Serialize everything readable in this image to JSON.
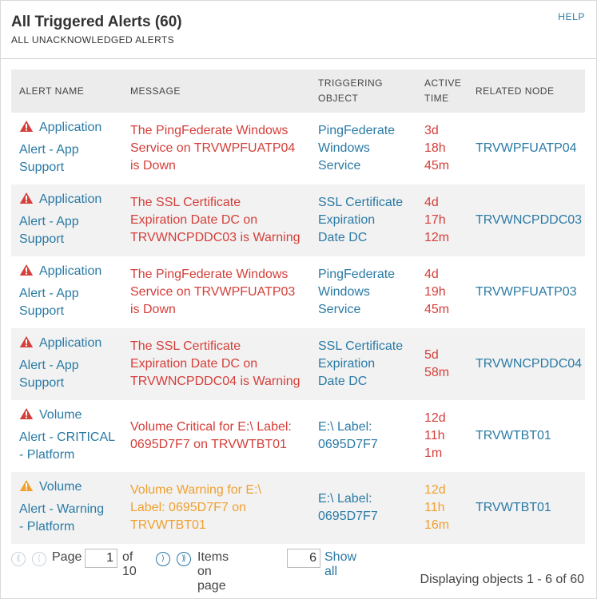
{
  "header": {
    "title": "All Triggered Alerts (60)",
    "subtitle": "ALL UNACKNOWLEDGED ALERTS",
    "help": "HELP"
  },
  "columns": {
    "alert_name": "ALERT NAME",
    "message": "MESSAGE",
    "triggering_line1": "TRIGGERING",
    "triggering_line2": "OBJECT",
    "active_line1": "ACTIVE",
    "active_line2": "TIME",
    "related_node": "RELATED NODE"
  },
  "rows": [
    {
      "name_line1": "Application",
      "name_line2": "Alert - App",
      "name_line3": "Support",
      "msg1": "The PingFederate Windows",
      "msg2": "Service on TRVWPFUATP04",
      "msg3": "is Down",
      "obj1": "PingFederate",
      "obj2": "Windows",
      "obj3": "Service",
      "t1": "3d",
      "t2": "18h",
      "t3": "45m",
      "node": "TRVWPFUATP04",
      "severity": "critical"
    },
    {
      "name_line1": "Application",
      "name_line2": "Alert - App",
      "name_line3": "Support",
      "msg1": "The SSL Certificate",
      "msg2": "Expiration Date DC on",
      "msg3": "TRVWNCPDDC03 is Warning",
      "obj1": "SSL Certificate",
      "obj2": "Expiration",
      "obj3": "Date DC",
      "t1": "4d",
      "t2": "17h",
      "t3": "12m",
      "node": "TRVWNCPDDC03",
      "severity": "critical"
    },
    {
      "name_line1": "Application",
      "name_line2": "Alert - App",
      "name_line3": "Support",
      "msg1": "The PingFederate Windows",
      "msg2": "Service on TRVWPFUATP03",
      "msg3": "is Down",
      "obj1": "PingFederate",
      "obj2": "Windows",
      "obj3": "Service",
      "t1": "4d",
      "t2": "19h",
      "t3": "45m",
      "node": "TRVWPFUATP03",
      "severity": "critical"
    },
    {
      "name_line1": "Application",
      "name_line2": "Alert - App",
      "name_line3": "Support",
      "msg1": "The SSL Certificate",
      "msg2": "Expiration Date DC on",
      "msg3": "TRVWNCPDDC04 is Warning",
      "obj1": "SSL Certificate",
      "obj2": "Expiration",
      "obj3": "Date DC",
      "t1": "5d",
      "t2": "58m",
      "t3": "",
      "node": "TRVWNCPDDC04",
      "severity": "critical"
    },
    {
      "name_line1": "Volume",
      "name_line2": "Alert - CRITICAL",
      "name_line3": "- Platform",
      "msg1": "Volume Critical for E:\\ Label:",
      "msg2": "0695D7F7 on TRVWTBT01",
      "msg3": "",
      "obj1": "E:\\ Label:",
      "obj2": "0695D7F7",
      "obj3": "",
      "t1": "12d",
      "t2": "11h",
      "t3": "1m",
      "node": "TRVWTBT01",
      "severity": "critical"
    },
    {
      "name_line1": "Volume",
      "name_line2": "Alert - Warning",
      "name_line3": "- Platform",
      "msg1": "Volume Warning for E:\\",
      "msg2": "Label: 0695D7F7 on",
      "msg3": "TRVWTBT01",
      "obj1": "E:\\ Label:",
      "obj2": "0695D7F7",
      "obj3": "",
      "t1": "12d",
      "t2": "11h",
      "t3": "16m",
      "node": "TRVWTBT01",
      "severity": "warning"
    }
  ],
  "pager": {
    "page_label": "Page",
    "page_value": "1",
    "of_label": "of 10",
    "items_label": "Items on page",
    "items_value": "6",
    "show_all": "Show all",
    "displaying": "Displaying objects 1 - 6 of 60"
  },
  "colors": {
    "link": "#2a7aa5",
    "critical": "#d43f3a",
    "warning": "#f0a030",
    "header_bg": "#ececec",
    "alt_row": "#f2f2f2"
  }
}
